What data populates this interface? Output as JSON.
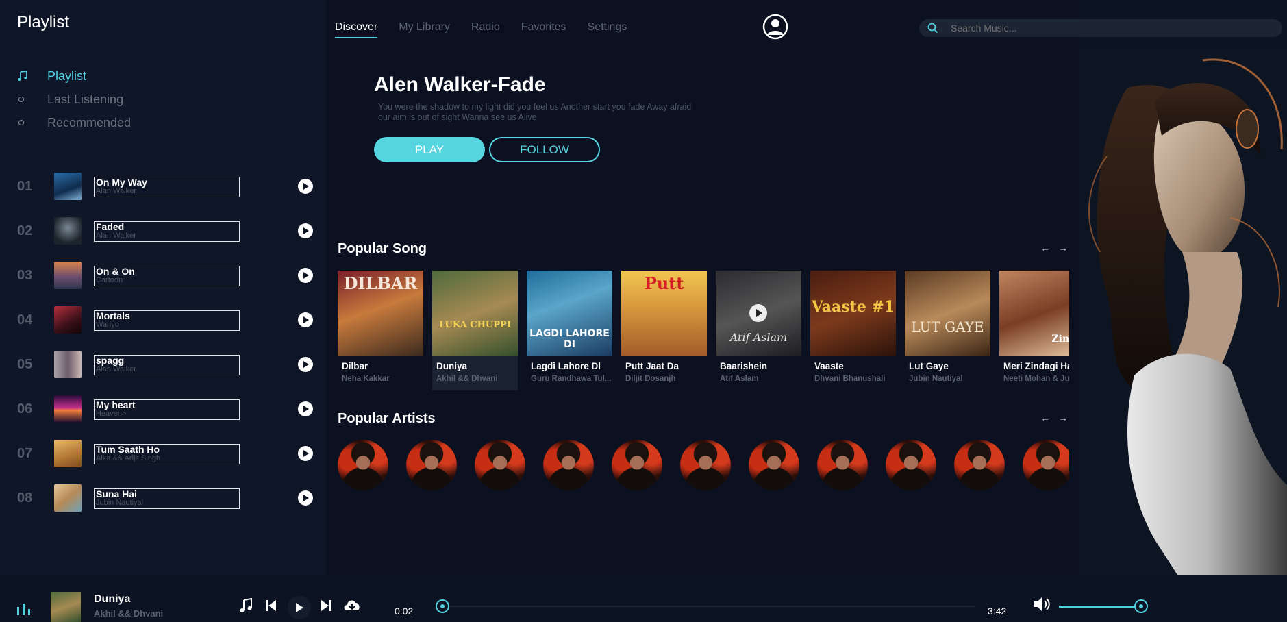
{
  "app": {
    "title": "Playlist"
  },
  "sidebar": {
    "nav": [
      {
        "label": "Playlist",
        "active": true
      },
      {
        "label": "Last Listening"
      },
      {
        "label": "Recommended"
      }
    ],
    "tracks": [
      {
        "num": "01",
        "title": "On My Way",
        "artist": "Alan Walker"
      },
      {
        "num": "02",
        "title": "Faded",
        "artist": "Alan Walker"
      },
      {
        "num": "03",
        "title": "On & On",
        "artist": "Cartoon"
      },
      {
        "num": "04",
        "title": "Mortals",
        "artist": "Wariyo"
      },
      {
        "num": "05",
        "title": "spagg",
        "artist": "Alan Walker"
      },
      {
        "num": "06",
        "title": "My heart",
        "artist": "Heaven>"
      },
      {
        "num": "07",
        "title": "Tum Saath Ho",
        "artist": "Alka && Arijit Singh"
      },
      {
        "num": "08",
        "title": "Suna Hai",
        "artist": "Jubin Nautiyal"
      }
    ]
  },
  "header": {
    "tabs": [
      {
        "label": "Discover",
        "active": true
      },
      {
        "label": "My Library"
      },
      {
        "label": "Radio"
      },
      {
        "label": "Favorites"
      },
      {
        "label": "Settings"
      }
    ],
    "search": {
      "placeholder": "Search Music..."
    }
  },
  "hero": {
    "title": "Alen Walker-Fade",
    "subtitle": "You were the shadow to my light did you feel us Another start you fade Away afraid our aim is out of sight Wanna see us Alive",
    "play_label": "PLAY",
    "follow_label": "FOLLOW"
  },
  "popular_songs": {
    "title": "Popular Song",
    "prev": "←",
    "next": "→",
    "items": [
      {
        "title": "Dilbar",
        "artist": "Neha Kakkar",
        "cover_text": "DILBAR"
      },
      {
        "title": "Duniya",
        "artist": "Akhil && Dhvani",
        "cover_text": "LUKA CHUPPI",
        "selected": true
      },
      {
        "title": "Lagdi Lahore Dl",
        "artist": "Guru Randhawa Tul...",
        "cover_text": "LAGDI LAHORE DI"
      },
      {
        "title": "Putt Jaat Da",
        "artist": "Diljit Dosanjh",
        "cover_text": "Putt"
      },
      {
        "title": "Baarishein",
        "artist": "Atif Aslam",
        "cover_text": "Atif Aslam"
      },
      {
        "title": "Vaaste",
        "artist": "Dhvani Bhanushali",
        "cover_text": "Vaaste #1"
      },
      {
        "title": "Lut Gaye",
        "artist": "Jubin Nautiyal",
        "cover_text": "LUT GAYE"
      },
      {
        "title": "Meri Zindagi Hai",
        "artist": "Neeti Mohan & Jubin",
        "cover_text": "Zinda"
      }
    ]
  },
  "popular_artists": {
    "title": "Popular Artists",
    "prev": "←",
    "next": "→",
    "count": 11
  },
  "player": {
    "title": "Duniya",
    "artist": "Akhil && Dhvani",
    "current_time": "0:02",
    "total_time": "3:42",
    "progress": 0.01,
    "volume": 0.92
  },
  "colors": {
    "accent": "#56d5e1",
    "background": "#0b1120",
    "sidebar": "#0e1628"
  }
}
